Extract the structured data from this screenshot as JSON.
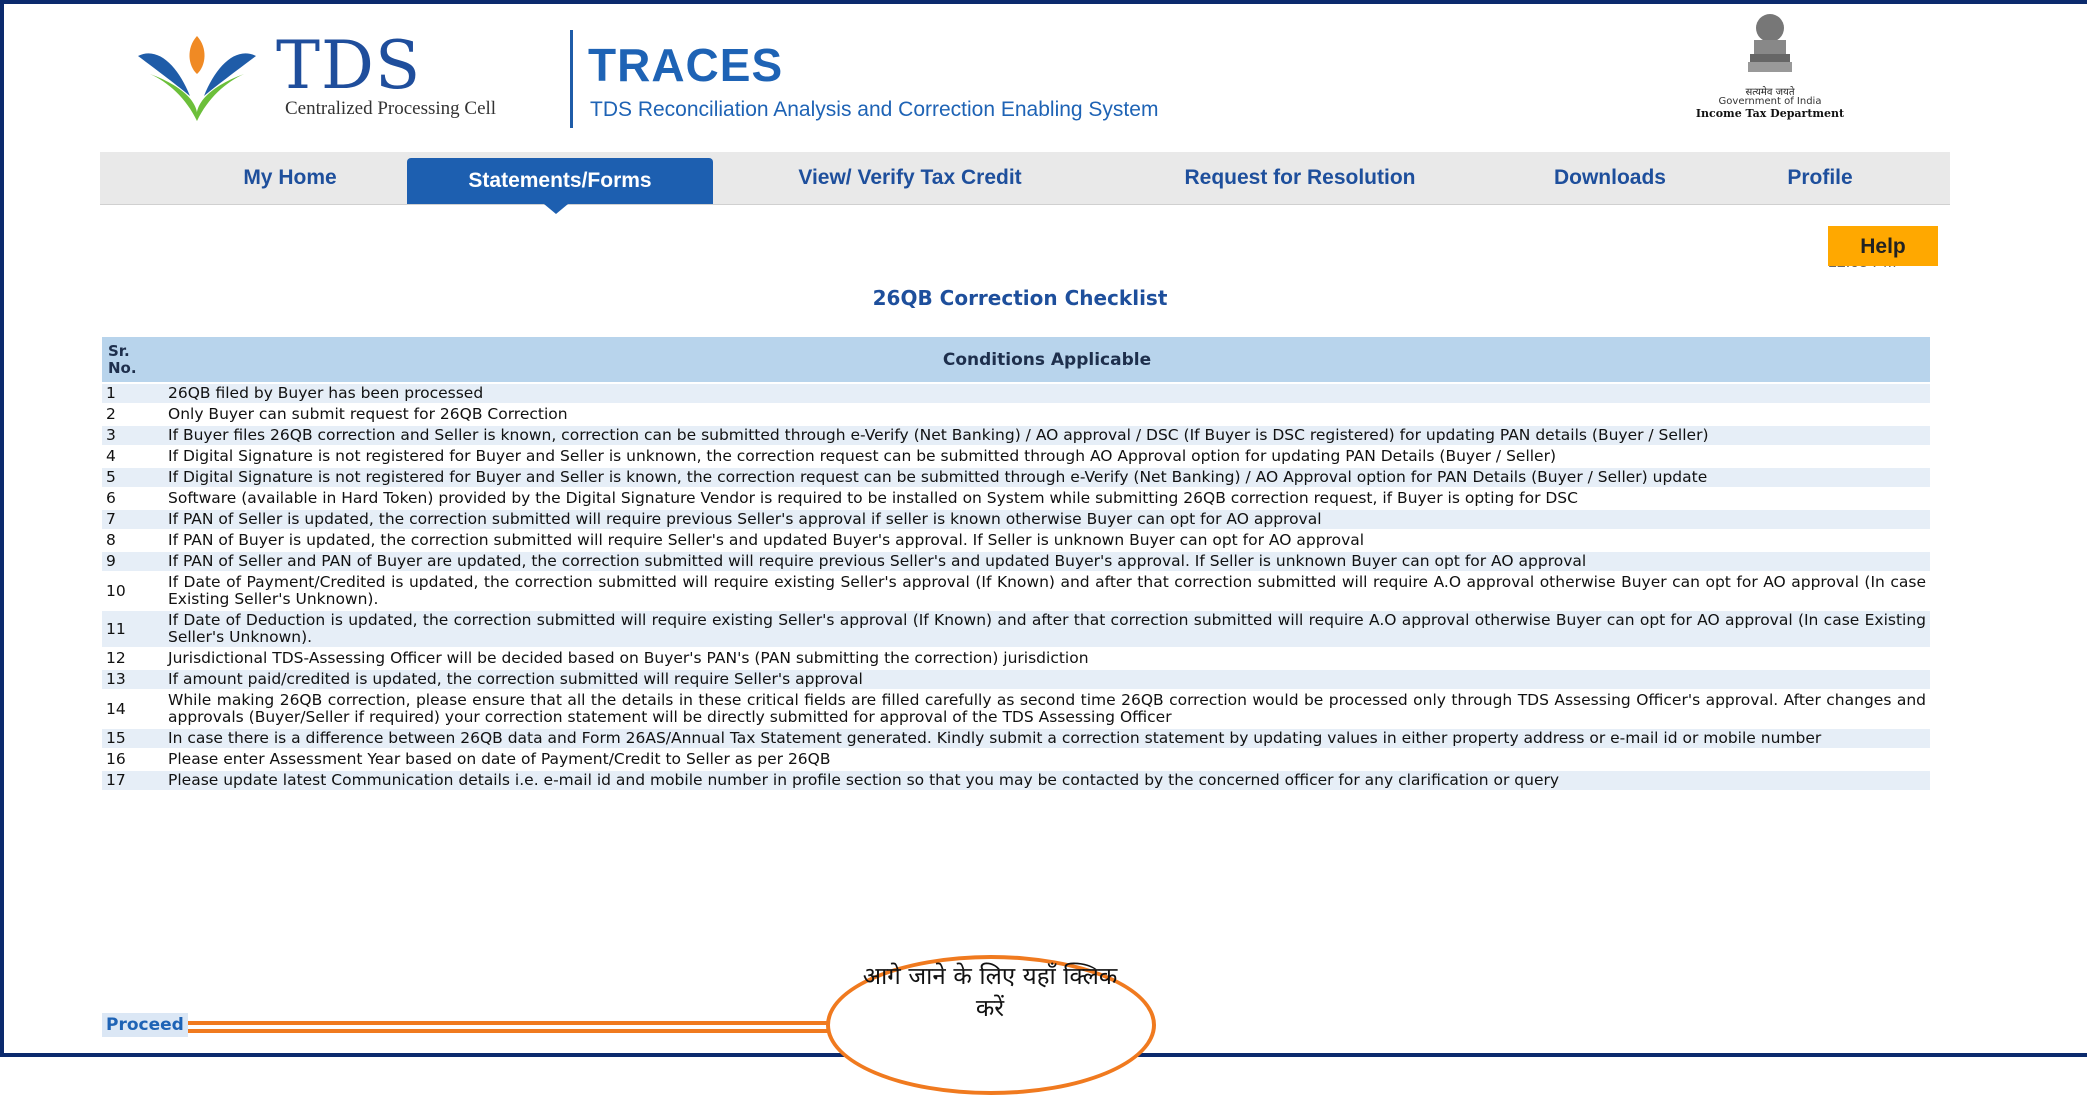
{
  "header": {
    "tds_title": "TDS",
    "tds_subtitle": "Centralized Processing Cell",
    "traces_title": "TRACES",
    "traces_subtitle": "TDS Reconciliation Analysis and Correction Enabling System",
    "emblem_line0": "सत्यमेव जयते",
    "emblem_line1": "Government of India",
    "emblem_line2": "Income Tax Department"
  },
  "nav": {
    "items": [
      {
        "label": "My Home"
      },
      {
        "label": "Statements/Forms"
      },
      {
        "label": "View/ Verify Tax Credit"
      },
      {
        "label": "Request for Resolution"
      },
      {
        "label": "Downloads"
      },
      {
        "label": "Profile"
      }
    ],
    "active": "Statements/Forms"
  },
  "help_label": "Help",
  "time_text": "12:05 PM",
  "page_title": "26QB Correction Checklist",
  "table": {
    "header_sr": "Sr. No.",
    "header_conditions": "Conditions Applicable",
    "rows": [
      {
        "sr": "1",
        "text": "26QB filed by Buyer has been processed"
      },
      {
        "sr": "2",
        "text": "Only Buyer can submit request for 26QB Correction"
      },
      {
        "sr": "3",
        "text": "If Buyer files 26QB correction and Seller is known, correction can be submitted through e-Verify (Net Banking) / AO approval / DSC (If Buyer is DSC registered) for updating PAN details (Buyer / Seller)"
      },
      {
        "sr": "4",
        "text": "If Digital Signature is not registered for Buyer and Seller is unknown, the correction request can be submitted through AO Approval option for updating PAN Details (Buyer / Seller)"
      },
      {
        "sr": "5",
        "text": "If Digital Signature is not registered for Buyer and Seller is known, the correction request can be submitted through e-Verify (Net Banking) / AO Approval option for PAN Details (Buyer / Seller) update"
      },
      {
        "sr": "6",
        "text": "Software (available in Hard Token) provided by the Digital Signature Vendor is required to be installed on System while submitting 26QB correction request, if Buyer is opting for DSC"
      },
      {
        "sr": "7",
        "text": "If PAN of Seller is updated, the correction submitted will require previous Seller's approval if seller is known otherwise Buyer can opt for AO approval"
      },
      {
        "sr": "8",
        "text": "If PAN of Buyer is updated, the correction submitted will require Seller's and updated Buyer's approval. If Seller is unknown Buyer can opt for AO approval"
      },
      {
        "sr": "9",
        "text": "If PAN of Seller and PAN of Buyer are updated, the correction submitted will require previous Seller's and updated Buyer's approval. If Seller is unknown Buyer can opt for AO approval"
      },
      {
        "sr": "10",
        "text": "If Date of Payment/Credited is updated, the correction submitted will require existing Seller's approval (If Known) and after that correction submitted will require A.O approval otherwise Buyer can opt for AO approval (In case Existing Seller's Unknown)."
      },
      {
        "sr": "11",
        "text": "If Date of Deduction is updated, the correction submitted will require existing Seller's approval (If Known) and after that correction submitted will require A.O approval otherwise Buyer can opt for AO approval (In case Existing Seller's Unknown)."
      },
      {
        "sr": "12",
        "text": "Jurisdictional TDS-Assessing Officer will be decided based on Buyer's PAN's (PAN submitting the correction) jurisdiction"
      },
      {
        "sr": "13",
        "text": "If amount paid/credited is updated, the correction submitted will require Seller's approval"
      },
      {
        "sr": "14",
        "text": "While making 26QB correction, please ensure that all the details in these critical fields are filled carefully as second time 26QB correction would be processed only through TDS Assessing Officer's approval. After changes and approvals (Buyer/Seller if required) your correction statement will be directly submitted for approval of the TDS Assessing Officer"
      },
      {
        "sr": "15",
        "text": "In case there is a difference between 26QB data and Form 26AS/Annual Tax Statement generated. Kindly submit a correction statement by updating values in either property address or e-mail id or mobile number"
      },
      {
        "sr": "16",
        "text": "Please enter Assessment Year based on date of Payment/Credit to Seller as per 26QB"
      },
      {
        "sr": "17",
        "text": "Please update latest Communication details i.e. e-mail id and mobile number in profile section so that you may be contacted by the concerned officer for any clarification or query"
      }
    ]
  },
  "proceed_label": "Proceed",
  "callout_text": "आगे जाने के लिए यहाँ क्लिक करें",
  "colors": {
    "nav_active": "#1d5fb0",
    "help": "#ffa800",
    "callout_border": "#f07a1f",
    "table_header": "#b8d4ec"
  }
}
